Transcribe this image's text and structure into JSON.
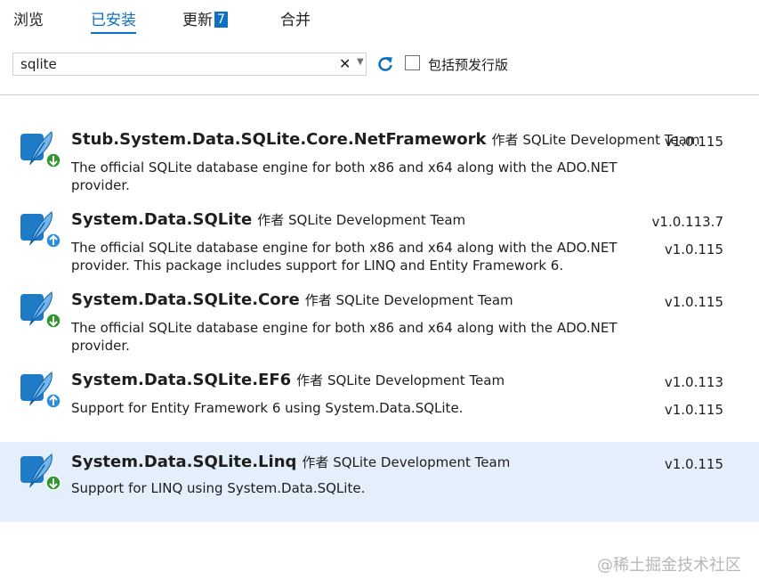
{
  "tabs": [
    {
      "label": "浏览"
    },
    {
      "label": "已安装"
    },
    {
      "label": "更新",
      "badge": "7"
    },
    {
      "label": "合并"
    }
  ],
  "search": {
    "value": "sqlite",
    "placeholder": ""
  },
  "prerelease_label": "包括预发行版",
  "author_prefix": "作者",
  "packages": [
    {
      "name": "Stub.System.Data.SQLite.Core.NetFramework",
      "author": "SQLite Development Team",
      "description": "The official SQLite database engine for both x86 and x64 along with the ADO.NET provider.",
      "version": "v1.0.115",
      "latest_version": "",
      "status_icon": "download-arrow-icon"
    },
    {
      "name": "System.Data.SQLite",
      "author": "SQLite Development Team",
      "description": "The official SQLite database engine for both x86 and x64 along with the ADO.NET provider.  This package includes support for LINQ and Entity Framework 6.",
      "version": "v1.0.113.7",
      "latest_version": "v1.0.115",
      "status_icon": "update-arrow-icon"
    },
    {
      "name": "System.Data.SQLite.Core",
      "author": "SQLite Development Team",
      "description": "The official SQLite database engine for both x86 and x64 along with the ADO.NET provider.",
      "version": "v1.0.115",
      "latest_version": "",
      "status_icon": "download-arrow-icon"
    },
    {
      "name": "System.Data.SQLite.EF6",
      "author": "SQLite Development Team",
      "description": "Support for Entity Framework 6 using System.Data.SQLite.",
      "version": "v1.0.113",
      "latest_version": "v1.0.115",
      "status_icon": "update-arrow-icon"
    },
    {
      "name": "System.Data.SQLite.Linq",
      "author": "SQLite Development Team",
      "description": "Support for LINQ using System.Data.SQLite.",
      "version": "v1.0.115",
      "latest_version": "",
      "status_icon": "download-arrow-icon"
    }
  ],
  "watermark": "@稀土掘金技术社区",
  "colors": {
    "accent": "#0e70c0",
    "selected_row": "#e5eefb",
    "status_green": "#2e9a2e",
    "status_blue": "#2a8ee0"
  }
}
